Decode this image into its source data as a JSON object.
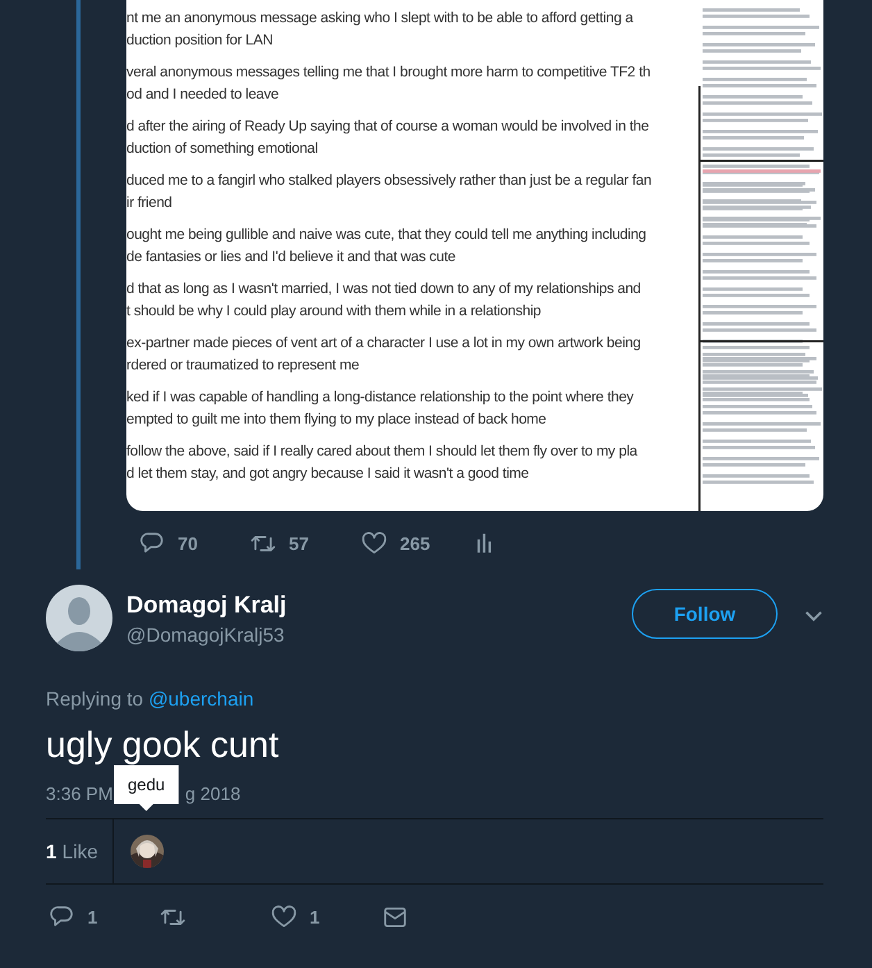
{
  "thread_tweet": {
    "attached_image": {
      "paragraphs": [
        {
          "lines": [
            "nt me an anonymous message asking who I slept with to be able to afford getting a",
            "duction position for LAN"
          ]
        },
        {
          "lines": [
            "veral anonymous messages telling me that I brought more harm to competitive TF2 th",
            "od and I needed to leave"
          ]
        },
        {
          "lines": [
            "d after the airing of Ready Up saying that of course a woman would be involved in the",
            "duction of something emotional"
          ]
        },
        {
          "lines": [
            "duced me to a fangirl who stalked players obsessively rather than just be a regular fan",
            "ir friend"
          ]
        },
        {
          "lines": [
            "ought me being gullible and naive was cute, that they could tell me anything including",
            "de fantasies or lies and I'd believe it and that was cute"
          ]
        },
        {
          "lines": [
            "d that as long as I wasn't married, I was not tied down to any of my relationships and",
            "t should be why I could play around with them while in a relationship"
          ]
        },
        {
          "lines": [
            "ex-partner made pieces of vent art of a character I use a lot in my own artwork being",
            "rdered or traumatized to represent me"
          ]
        },
        {
          "lines": [
            "ked if I was capable of handling a long-distance relationship to the point where they",
            "empted to guilt me into them flying to my place instead of back home"
          ]
        },
        {
          "lines": [
            "follow the above, said if I really cared about them I should let them fly over to my pla",
            "d let them stay, and got angry because I said it wasn't a good time"
          ]
        }
      ]
    },
    "actions": [
      {
        "kind": "reply",
        "count": "70"
      },
      {
        "kind": "retweet",
        "count": "57"
      },
      {
        "kind": "like",
        "count": "265"
      },
      {
        "kind": "analytics"
      }
    ]
  },
  "reply_tweet": {
    "author": {
      "name": "Domagoj Kralj",
      "handle": "@DomagojKralj53"
    },
    "follow_button": "Follow",
    "replying_to": {
      "label": "Replying to",
      "handle": "@uberchain"
    },
    "text": "ugly gook cunt",
    "timestamp_parts": [
      "3:36 PM",
      "g 2018"
    ],
    "tooltip": "gedu",
    "likes": {
      "count": "1",
      "label": "Like"
    },
    "actions": [
      {
        "kind": "reply",
        "count": "1"
      },
      {
        "kind": "retweet"
      },
      {
        "kind": "like",
        "count": "1"
      },
      {
        "kind": "message"
      }
    ]
  }
}
